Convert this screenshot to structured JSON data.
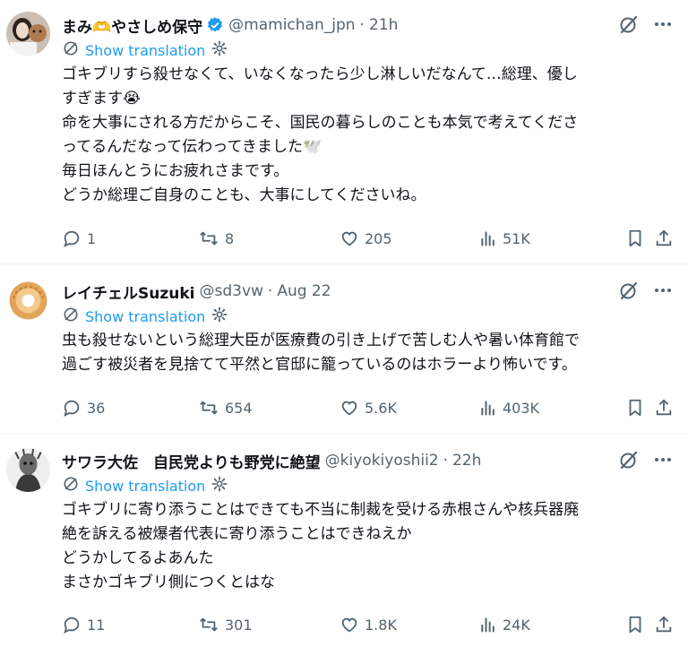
{
  "colors": {
    "accent": "#1d9bf0",
    "muted": "#536471",
    "text": "#0f1419",
    "divider": "#eff3f4"
  },
  "tweets": [
    {
      "name": "まみ🫶やさしめ保守",
      "verified": true,
      "handle": "@mamichan_jpn",
      "time": "21h",
      "translate_label": "Show translation",
      "lines": [
        "ゴキブリすら殺せなくて、いなくなったら少し淋しいだなんて…総理、優し",
        "すぎます😭",
        "命を大事にされる方だからこそ、国民の暮らしのことも本気で考えてくださ",
        "ってるんだなって伝わってきました🕊️",
        "毎日ほんとうにお疲れさまです。",
        "どうか総理ご自身のことも、大事にしてくださいね。"
      ],
      "replies": "1",
      "reposts": "8",
      "likes": "205",
      "views": "51K"
    },
    {
      "name": "レイチェルSuzuki",
      "verified": false,
      "handle": "@sd3vw",
      "time": "Aug 22",
      "translate_label": "Show translation",
      "lines": [
        "虫も殺せないという総理大臣が医療費の引き上げで苦しむ人や暑い体育館で",
        "過ごす被災者を見捨てて平然と官邸に籠っているのはホラーより怖いです。"
      ],
      "replies": "36",
      "reposts": "654",
      "likes": "5.6K",
      "views": "403K"
    },
    {
      "name": "サワラ大佐　自民党よりも野党に絶望",
      "verified": false,
      "handle": "@kiyokiyoshii2",
      "time": "22h",
      "translate_label": "Show translation",
      "lines": [
        "ゴキブリに寄り添うことはできても不当に制裁を受ける赤根さんや核兵器廃",
        "絶を訴える被爆者代表に寄り添うことはできねえか",
        "どうかしてるよあんた",
        "まさかゴキブリ側につくとはな"
      ],
      "replies": "11",
      "reposts": "301",
      "likes": "1.8K",
      "views": "24K"
    }
  ]
}
